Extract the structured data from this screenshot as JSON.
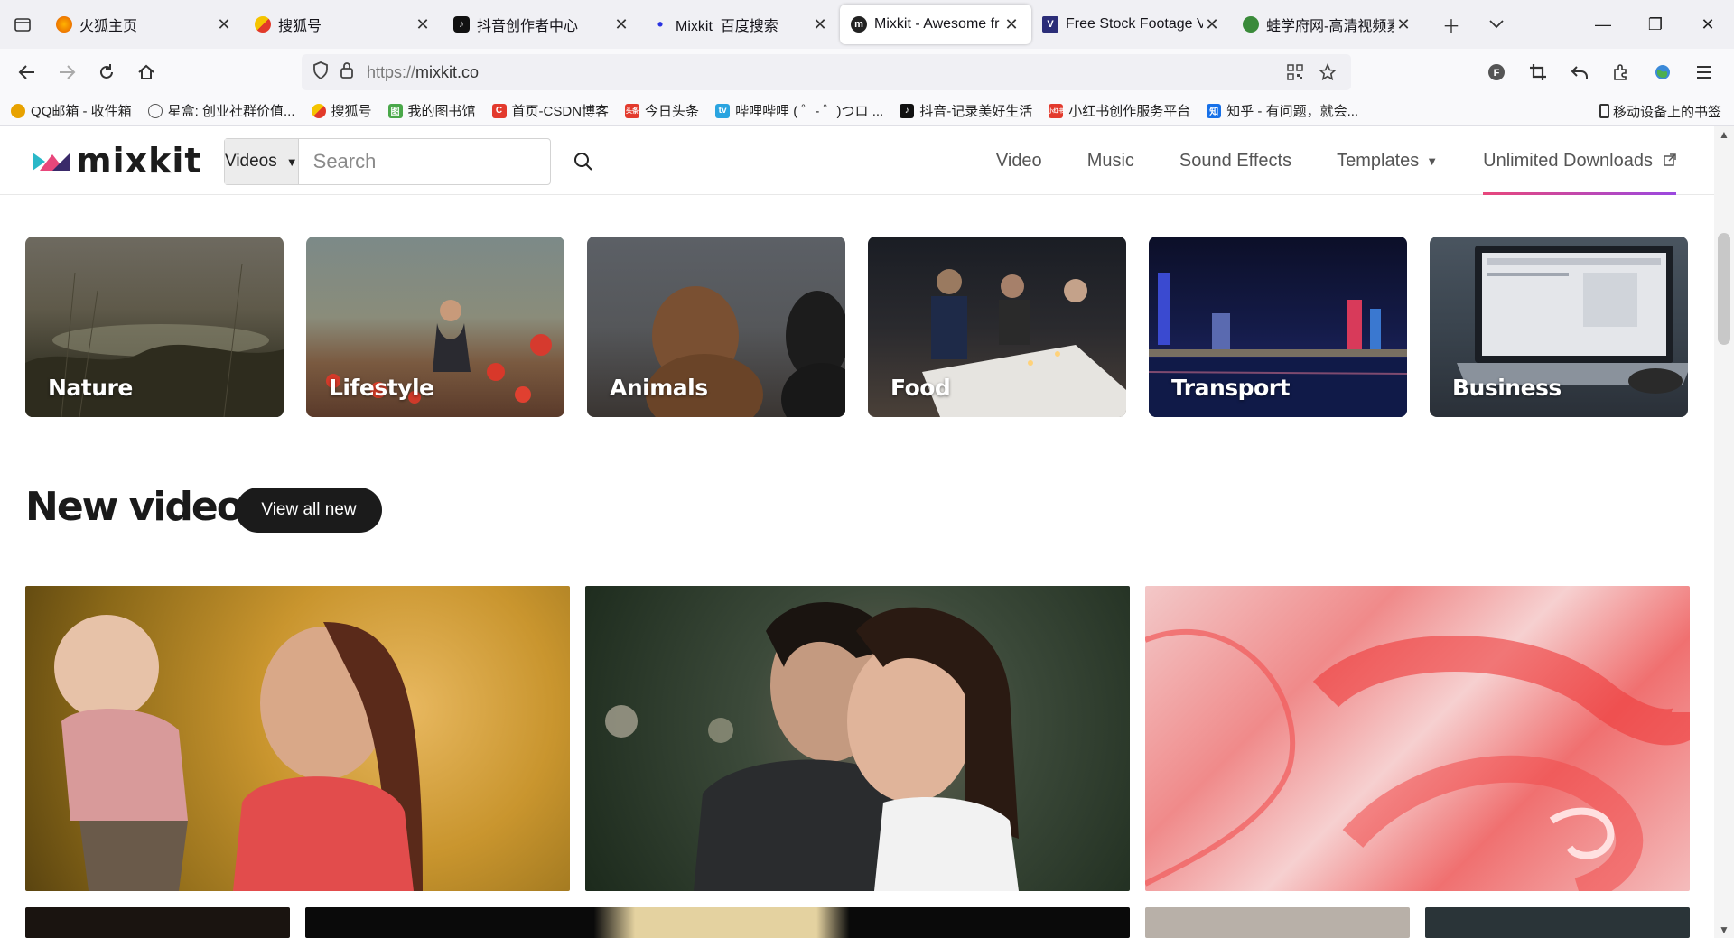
{
  "tabs": [
    {
      "title": "火狐主页",
      "fav": "firefox-icon",
      "color": "#e66000"
    },
    {
      "title": "搜狐号",
      "fav": "sohu-icon",
      "color": "#f5c400"
    },
    {
      "title": "抖音创作者中心",
      "fav": "douyin-icon",
      "color": "#111111"
    },
    {
      "title": "Mixkit_百度搜索",
      "fav": "baidu-icon",
      "color": "#2932e1"
    },
    {
      "title": "Mixkit - Awesome fr",
      "fav": "mixkit-icon",
      "color": "#222222",
      "active": true
    },
    {
      "title": "Free Stock Footage V",
      "fav": "videvo-icon",
      "color": "#2b2d78"
    },
    {
      "title": "蛙学府网-高清视频素",
      "fav": "waxuefu-icon",
      "color": "#3a8a3a"
    }
  ],
  "url": {
    "protocol": "https://",
    "host": "mixkit.co"
  },
  "bookmarks": [
    {
      "label": "QQ邮箱 - 收件箱",
      "color": "#e8a200"
    },
    {
      "label": "星盒: 创业社群价值...",
      "color": "#666666"
    },
    {
      "label": "搜狐号",
      "color": "#f5c400"
    },
    {
      "label": "我的图书馆",
      "color": "#4aa84a"
    },
    {
      "label": "首页-CSDN博客",
      "color": "#e33a2d"
    },
    {
      "label": "今日头条",
      "color": "#e33a2d"
    },
    {
      "label": "哔哩哔哩 ( ゜- ゜)つロ ...",
      "color": "#2aa4e0"
    },
    {
      "label": "抖音-记录美好生活",
      "color": "#111111"
    },
    {
      "label": "小红书创作服务平台",
      "color": "#e33a2d"
    },
    {
      "label": "知乎 - 有问题，就会...",
      "color": "#1670e8"
    }
  ],
  "bookmarks_mobile": "移动设备上的书签",
  "site": {
    "logo": "mixkit",
    "search_category": "Videos",
    "search_placeholder": "Search",
    "nav": {
      "video": "Video",
      "music": "Music",
      "sound_effects": "Sound Effects",
      "templates": "Templates",
      "unlimited": "Unlimited Downloads"
    }
  },
  "categories": [
    "Nature",
    "Lifestyle",
    "Animals",
    "Food",
    "Transport",
    "Business"
  ],
  "new_videos": {
    "title": "New videos",
    "view_all": "View all new"
  }
}
